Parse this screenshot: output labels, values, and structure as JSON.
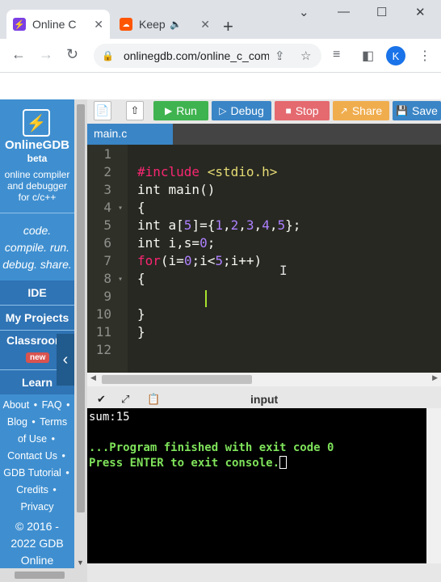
{
  "browser": {
    "tabs": [
      {
        "title": "Online C Compiler",
        "icon": "onlinegdb-favicon"
      },
      {
        "title": "Keep Calm",
        "icon": "soundcloud-favicon"
      }
    ],
    "new_tab": "+",
    "url": "onlinegdb.com/online_c_compiler",
    "profile_initial": "K"
  },
  "sidebar": {
    "brand": "OnlineGDB",
    "beta": "beta",
    "tagline_1": "online compiler",
    "tagline_2": "and debugger",
    "tagline_3": "for c/c++",
    "motto_1": "code.",
    "motto_2": "compile. run.",
    "motto_3": "debug. share.",
    "nav": [
      "IDE",
      "My Projects",
      "Classroom",
      "Learn"
    ],
    "new_badge": "new",
    "links": {
      "about": "About",
      "faq": "FAQ",
      "blog": "Blog",
      "terms_1": "Terms",
      "terms_2": "of Use",
      "contact": "Contact Us",
      "tutorial": "GDB Tutorial",
      "credits": "Credits",
      "privacy": "Privacy",
      "bullet": "•"
    },
    "copyright_1": "© 2016 -",
    "copyright_2": "2022 GDB",
    "copyright_3": "Online"
  },
  "toolbar": {
    "run": "Run",
    "debug": "Debug",
    "stop": "Stop",
    "share": "Share",
    "save": "Save"
  },
  "file_tab": "main.c",
  "editor": {
    "line_numbers": [
      "1",
      "2",
      "3",
      "4",
      "5",
      "6",
      "7",
      "8",
      "9",
      "10",
      "11",
      "12"
    ],
    "lines": {
      "l2_pre": "#include",
      "l2_inc": "<stdio.h>",
      "l3": "int main()",
      "l4": "{",
      "l5_a": "int a[",
      "l5_n5": "5",
      "l5_b": "]={",
      "l5_n1": "1",
      "l5_n2": "2",
      "l5_n3": "3",
      "l5_n4": "4",
      "l5_n5b": "5",
      "l5_c": "};",
      "comma": ",",
      "l6_a": "int i,s=",
      "l6_n0": "0",
      "l6_b": ";",
      "l7_for": "for",
      "l7_a": "(i=",
      "l7_n0": "0",
      "l7_b": ";i<",
      "l7_n5": "5",
      "l7_c": ";i++)",
      "l8": "{",
      "l10": "}",
      "l11": "}"
    }
  },
  "console": {
    "title": "input",
    "output_1": "sum:15",
    "output_2": "...Program finished with exit code 0",
    "output_3": "Press ENTER to exit console."
  }
}
